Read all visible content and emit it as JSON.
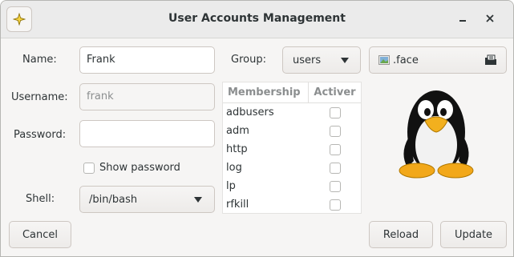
{
  "window": {
    "title": "User Accounts Management"
  },
  "form": {
    "name_label": "Name:",
    "name_value": "Frank",
    "username_label": "Username:",
    "username_value": "frank",
    "password_label": "Password:",
    "password_value": "",
    "show_password_label": "Show password",
    "shell_label": "Shell:",
    "shell_value": "/bin/bash",
    "group_label": "Group:",
    "group_value": "users",
    "face_file": ".face"
  },
  "membership": {
    "col_name": "Membership",
    "col_active": "Activer",
    "groups": [
      {
        "name": "adbusers",
        "active": false
      },
      {
        "name": "adm",
        "active": false
      },
      {
        "name": "http",
        "active": false
      },
      {
        "name": "log",
        "active": false
      },
      {
        "name": "lp",
        "active": false
      },
      {
        "name": "rfkill",
        "active": false
      }
    ]
  },
  "buttons": {
    "cancel": "Cancel",
    "reload": "Reload",
    "update": "Update"
  }
}
